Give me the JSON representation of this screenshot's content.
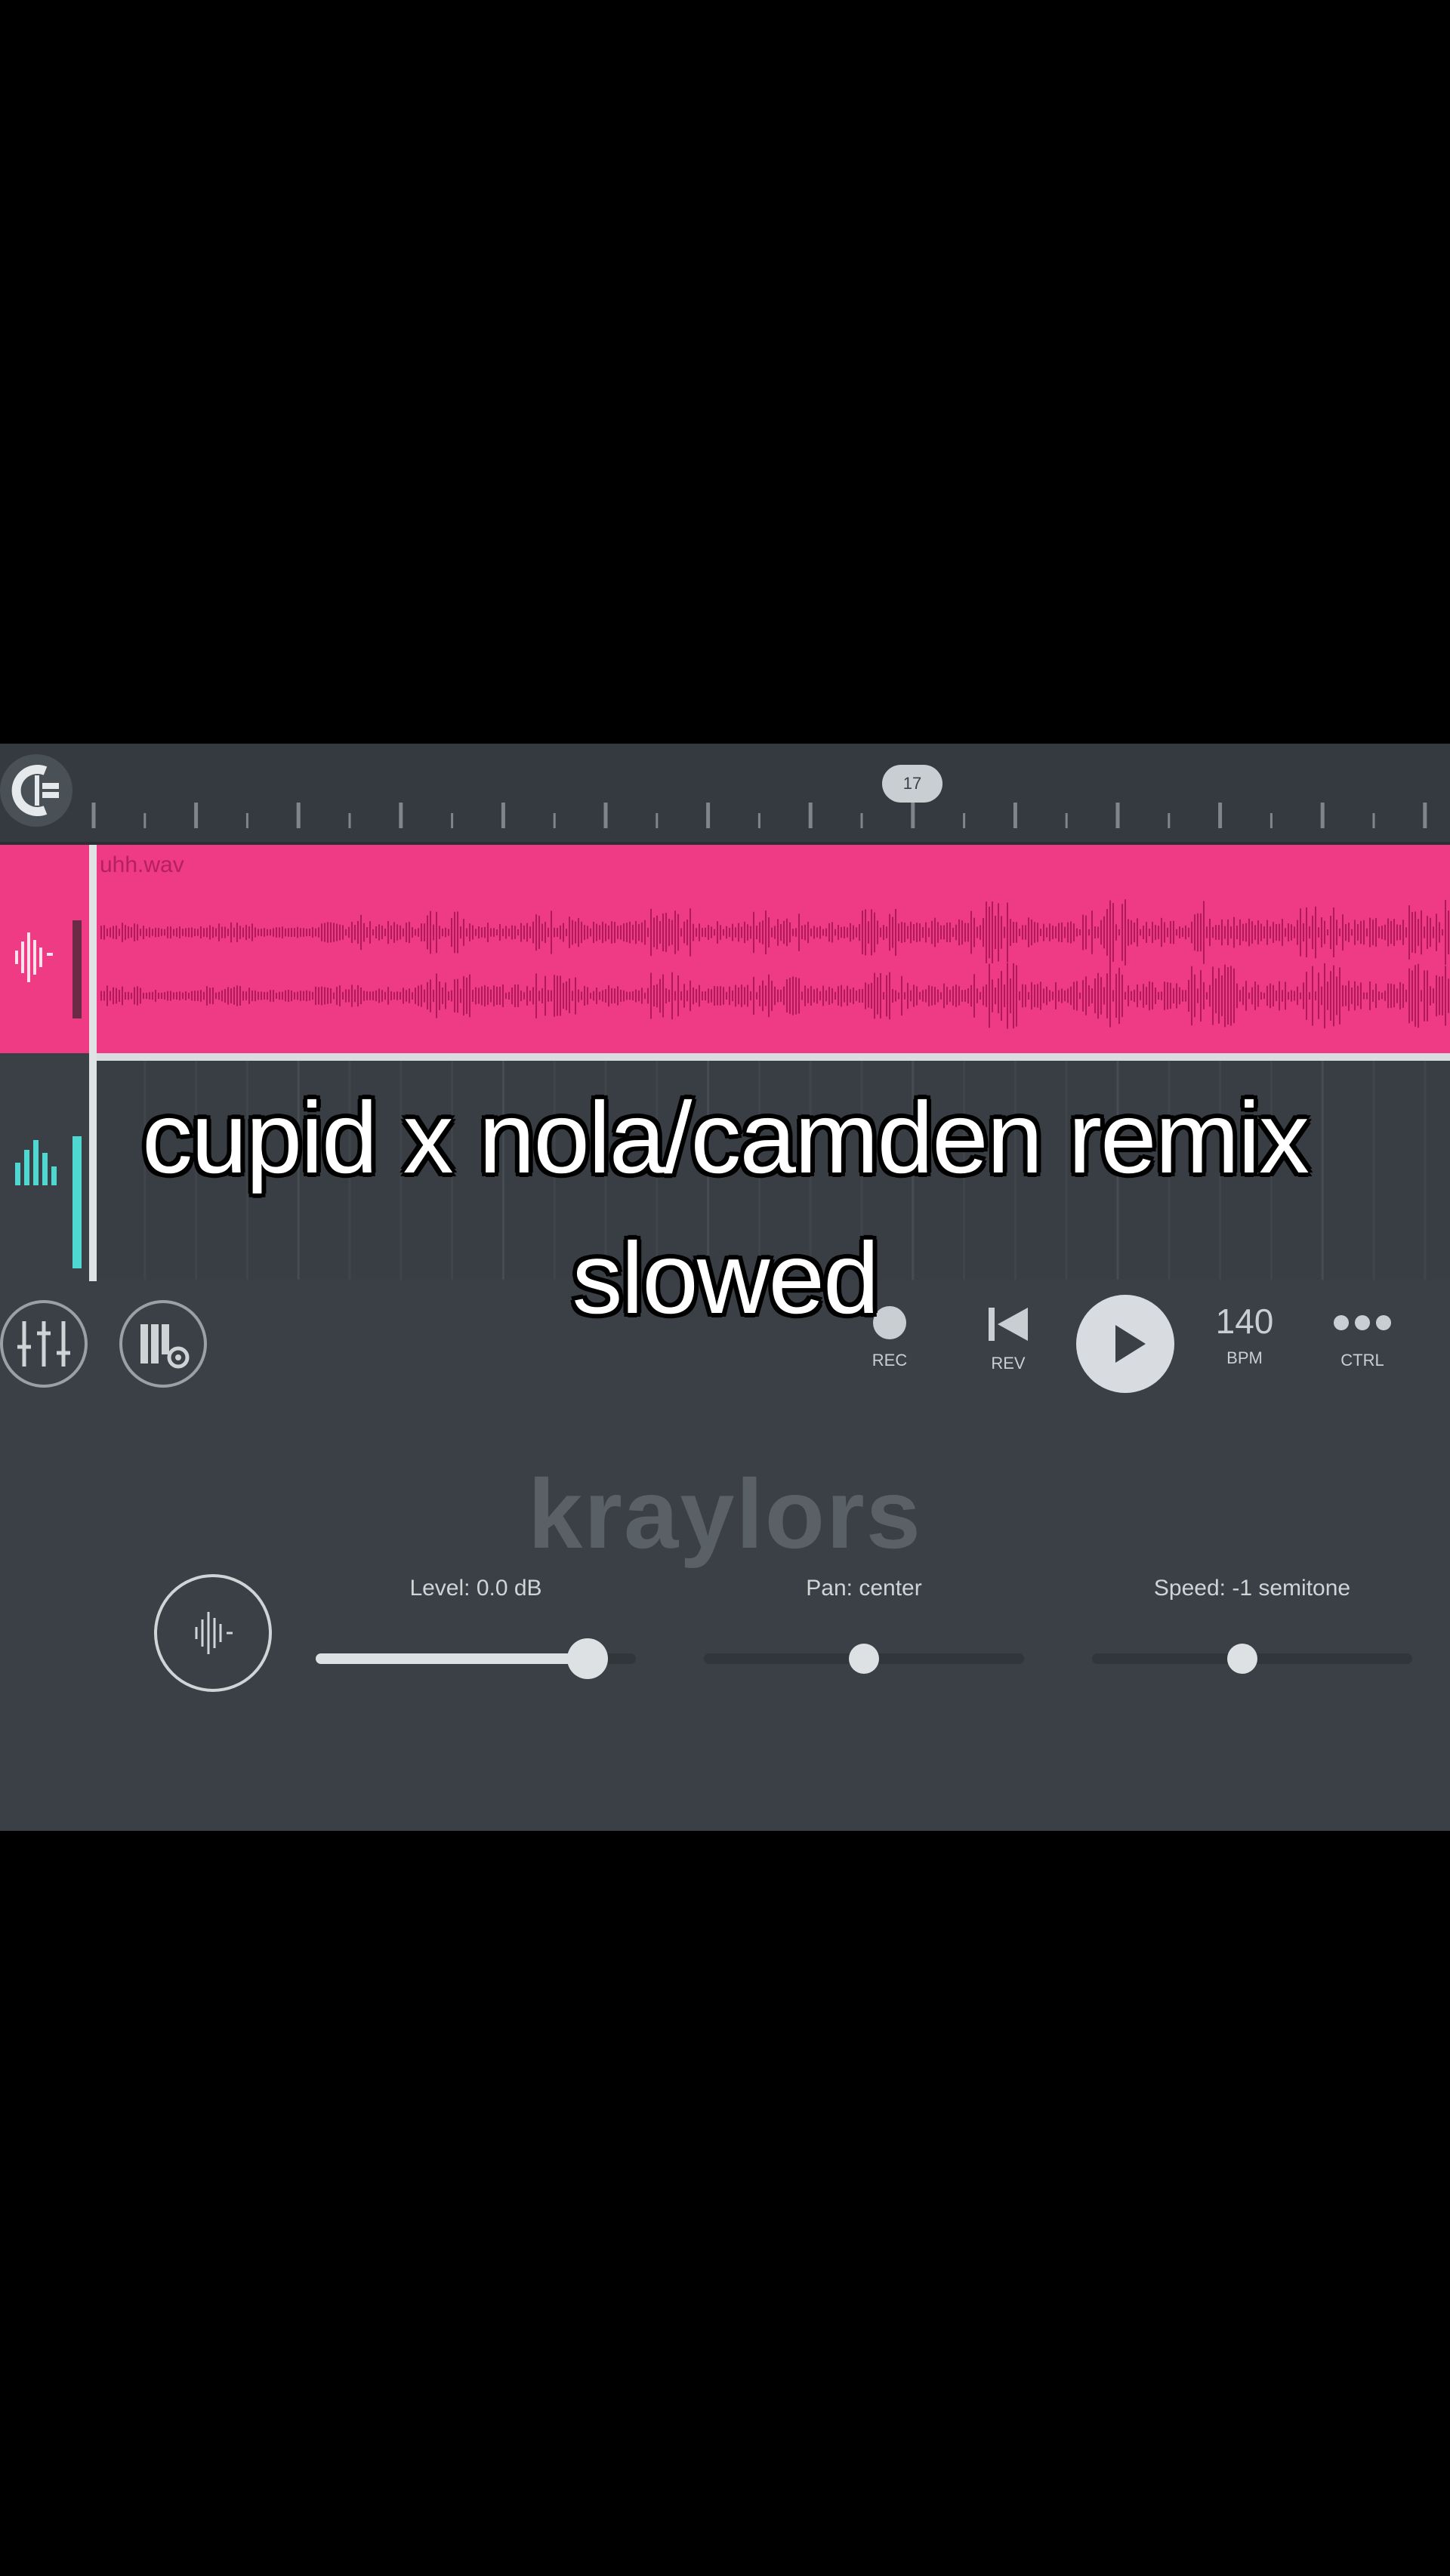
{
  "timeline": {
    "marker_label": "17"
  },
  "tracks": [
    {
      "clip_name": "uhh.wav",
      "color": "#ef3a86",
      "icon": "waveform-icon"
    },
    {
      "icon": "equalizer-bars-icon",
      "color": "#4fd8d2"
    }
  ],
  "caption": {
    "line1": "cupid x nola/camden remix",
    "line2": "slowed"
  },
  "toolbar": {
    "mixer_icon": "mixer-sliders-icon",
    "settings_icon": "piano-settings-icon",
    "rec_label": "REC",
    "rev_label": "REV",
    "bpm_value": "140",
    "bpm_label": "BPM",
    "ctrl_label": "CTRL"
  },
  "watermark": "kraylors",
  "sampler": {
    "icon": "sample-waveform-icon",
    "level": {
      "label": "Level: 0.0 dB",
      "value": 0.85
    },
    "pan": {
      "label": "Pan: center",
      "value": 0.5
    },
    "speed": {
      "label": "Speed: -1 semitone",
      "value": 0.47
    }
  }
}
